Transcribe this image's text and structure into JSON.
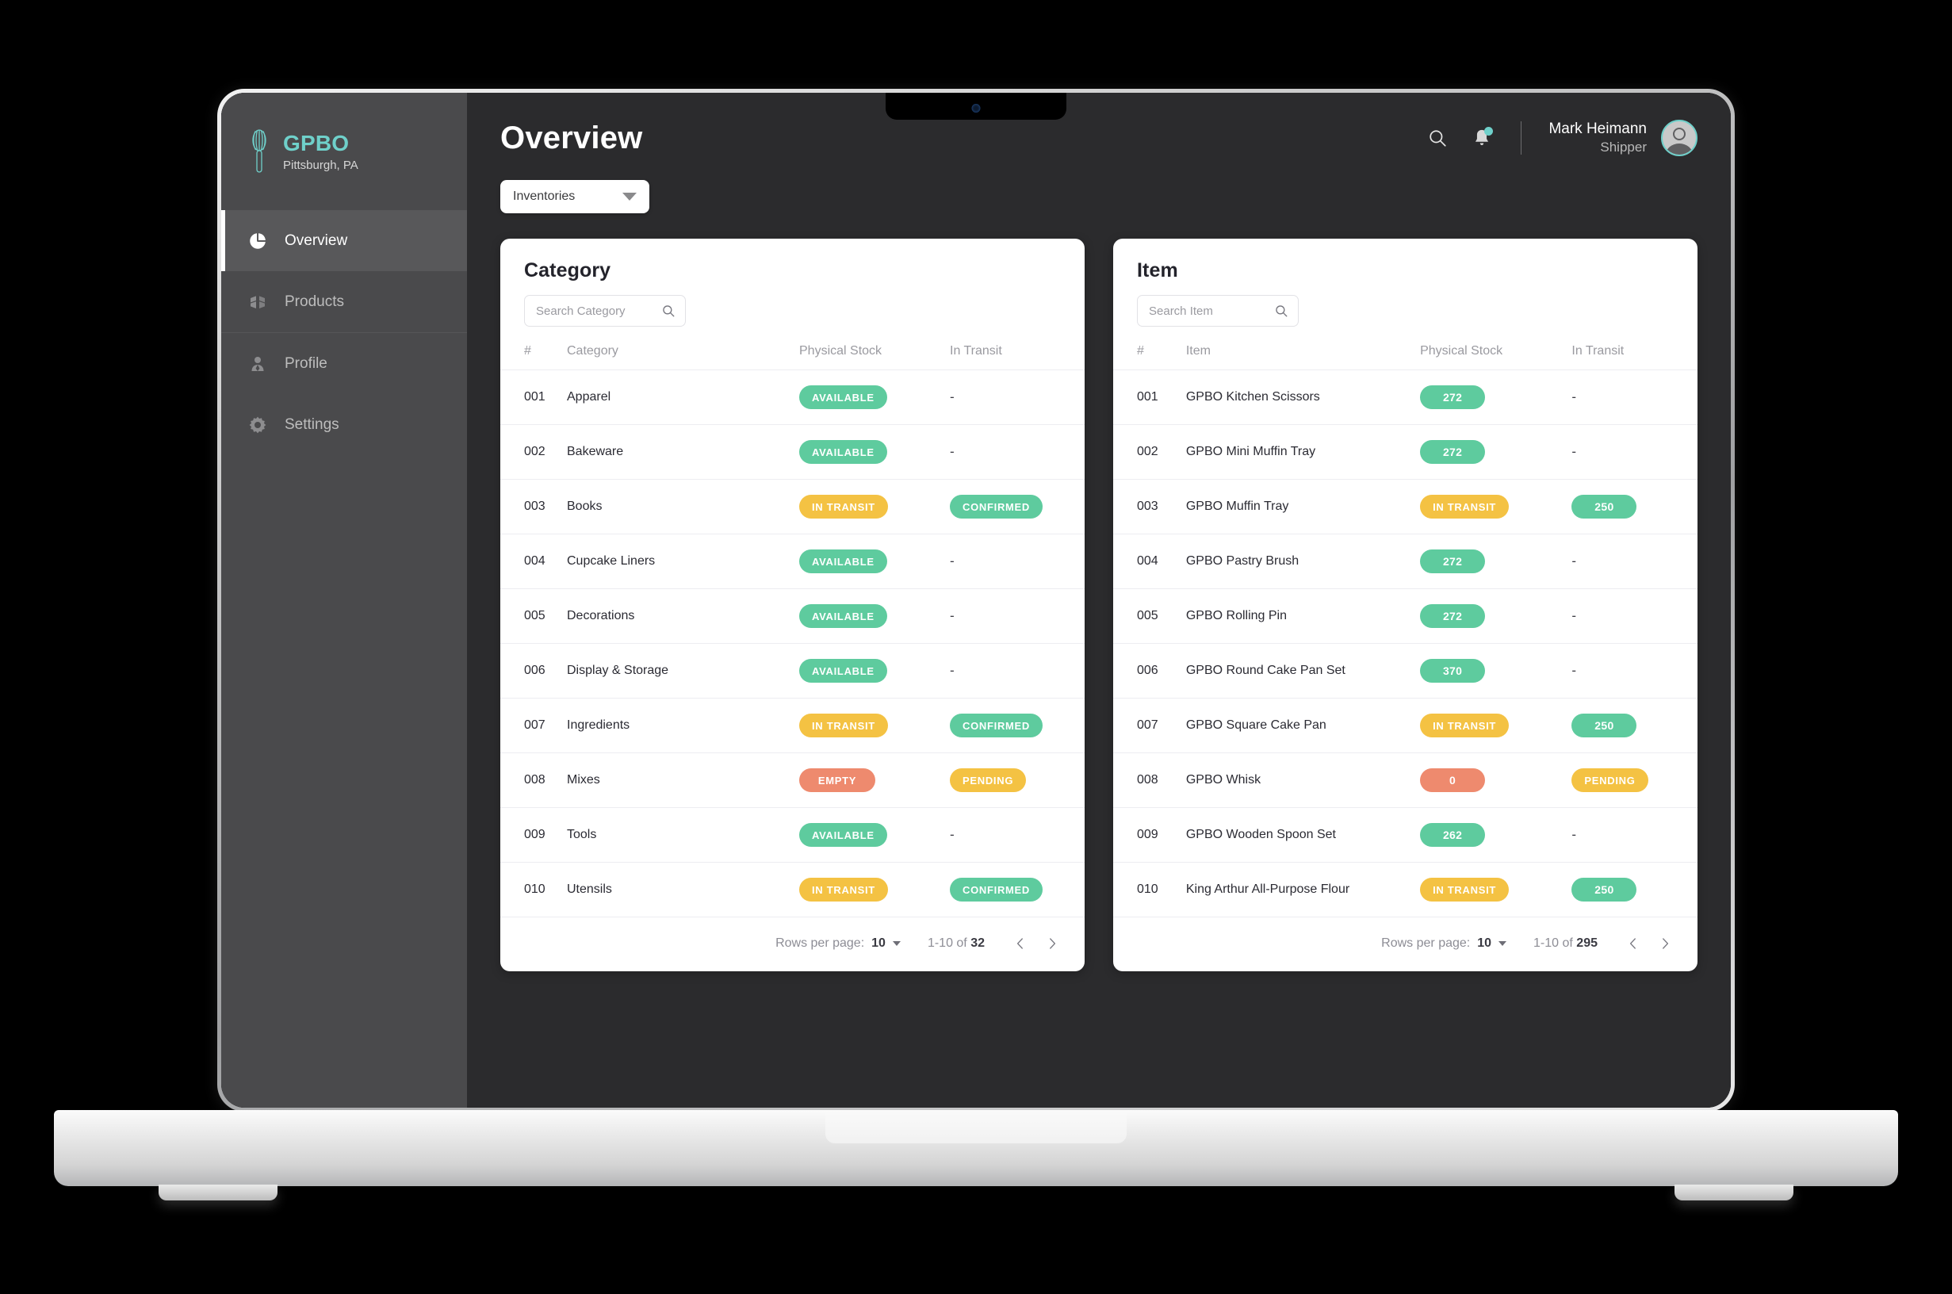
{
  "brand": {
    "name": "GPBO",
    "location": "Pittsburgh, PA",
    "logo_icon": "whisk-icon",
    "accent_color": "#6fd0ca"
  },
  "sidebar": {
    "items": [
      {
        "label": "Overview",
        "icon": "pie-chart-icon",
        "active": true
      },
      {
        "label": "Products",
        "icon": "box-icon",
        "active": false
      },
      {
        "label": "Profile",
        "icon": "person-icon",
        "active": false
      },
      {
        "label": "Settings",
        "icon": "gear-icon",
        "active": false
      }
    ]
  },
  "topbar": {
    "title": "Overview",
    "search_icon": "search-icon",
    "notification_icon": "bell-icon",
    "has_notification": true,
    "user": {
      "name": "Mark Heimann",
      "role": "Shipper",
      "avatar_icon": "avatar-icon"
    }
  },
  "inventory_select": {
    "value": "Inventories",
    "caret_icon": "chevron-down-icon"
  },
  "category_card": {
    "title": "Category",
    "search_placeholder": "Search Category",
    "search_icon": "search-icon",
    "columns": [
      "#",
      "Category",
      "Physical Stock",
      "In Transit"
    ],
    "rows": [
      {
        "num": "001",
        "name": "Apparel",
        "stock": "AVAILABLE",
        "stock_color": "green",
        "transit": "-",
        "transit_color": "none"
      },
      {
        "num": "002",
        "name": "Bakeware",
        "stock": "AVAILABLE",
        "stock_color": "green",
        "transit": "-",
        "transit_color": "none"
      },
      {
        "num": "003",
        "name": "Books",
        "stock": "IN TRANSIT",
        "stock_color": "yellow",
        "transit": "CONFIRMED",
        "transit_color": "green"
      },
      {
        "num": "004",
        "name": "Cupcake Liners",
        "stock": "AVAILABLE",
        "stock_color": "green",
        "transit": "-",
        "transit_color": "none"
      },
      {
        "num": "005",
        "name": "Decorations",
        "stock": "AVAILABLE",
        "stock_color": "green",
        "transit": "-",
        "transit_color": "none"
      },
      {
        "num": "006",
        "name": "Display & Storage",
        "stock": "AVAILABLE",
        "stock_color": "green",
        "transit": "-",
        "transit_color": "none"
      },
      {
        "num": "007",
        "name": "Ingredients",
        "stock": "IN TRANSIT",
        "stock_color": "yellow",
        "transit": "CONFIRMED",
        "transit_color": "green"
      },
      {
        "num": "008",
        "name": "Mixes",
        "stock": "EMPTY",
        "stock_color": "red",
        "transit": "PENDING",
        "transit_color": "yellow"
      },
      {
        "num": "009",
        "name": "Tools",
        "stock": "AVAILABLE",
        "stock_color": "green",
        "transit": "-",
        "transit_color": "none"
      },
      {
        "num": "010",
        "name": "Utensils",
        "stock": "IN TRANSIT",
        "stock_color": "yellow",
        "transit": "CONFIRMED",
        "transit_color": "green"
      }
    ],
    "footer": {
      "rows_per_page_label": "Rows per page:",
      "rows_per_page_value": "10",
      "range_prefix": "1-10 of ",
      "range_total": "32",
      "prev_icon": "chevron-left-icon",
      "next_icon": "chevron-right-icon"
    }
  },
  "item_card": {
    "title": "Item",
    "search_placeholder": "Search Item",
    "search_icon": "search-icon",
    "columns": [
      "#",
      "Item",
      "Physical Stock",
      "In Transit"
    ],
    "rows": [
      {
        "num": "001",
        "name": "GPBO Kitchen Scissors",
        "stock": "272",
        "stock_color": "green",
        "transit": "-",
        "transit_color": "none"
      },
      {
        "num": "002",
        "name": "GPBO Mini Muffin Tray",
        "stock": "272",
        "stock_color": "green",
        "transit": "-",
        "transit_color": "none"
      },
      {
        "num": "003",
        "name": "GPBO Muffin Tray",
        "stock": "IN TRANSIT",
        "stock_color": "yellow",
        "transit": "250",
        "transit_color": "green"
      },
      {
        "num": "004",
        "name": "GPBO Pastry Brush",
        "stock": "272",
        "stock_color": "green",
        "transit": "-",
        "transit_color": "none"
      },
      {
        "num": "005",
        "name": "GPBO Rolling Pin",
        "stock": "272",
        "stock_color": "green",
        "transit": "-",
        "transit_color": "none"
      },
      {
        "num": "006",
        "name": "GPBO Round Cake Pan Set",
        "stock": "370",
        "stock_color": "green",
        "transit": "-",
        "transit_color": "none"
      },
      {
        "num": "007",
        "name": "GPBO Square Cake Pan",
        "stock": "IN TRANSIT",
        "stock_color": "yellow",
        "transit": "250",
        "transit_color": "green"
      },
      {
        "num": "008",
        "name": "GPBO Whisk",
        "stock": "0",
        "stock_color": "red",
        "transit": "PENDING",
        "transit_color": "yellow"
      },
      {
        "num": "009",
        "name": "GPBO Wooden Spoon Set",
        "stock": "262",
        "stock_color": "green",
        "transit": "-",
        "transit_color": "none"
      },
      {
        "num": "010",
        "name": "King Arthur All-Purpose Flour",
        "stock": "IN TRANSIT",
        "stock_color": "yellow",
        "transit": "250",
        "transit_color": "green"
      }
    ],
    "footer": {
      "rows_per_page_label": "Rows per page:",
      "rows_per_page_value": "10",
      "range_prefix": "1-10 of ",
      "range_total": "295",
      "prev_icon": "chevron-left-icon",
      "next_icon": "chevron-right-icon"
    }
  }
}
